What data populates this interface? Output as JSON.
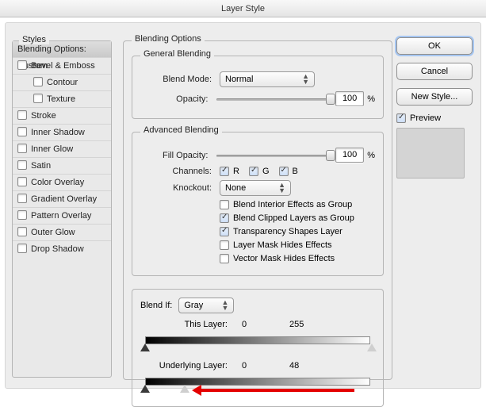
{
  "title": "Layer Style",
  "styles": {
    "header": "Styles",
    "selected": "Blending Options: Custom",
    "items": [
      "Bevel & Emboss",
      "Contour",
      "Texture",
      "Stroke",
      "Inner Shadow",
      "Inner Glow",
      "Satin",
      "Color Overlay",
      "Gradient Overlay",
      "Pattern Overlay",
      "Outer Glow",
      "Drop Shadow"
    ]
  },
  "blend": {
    "groupTitle": "Blending Options",
    "general": {
      "title": "General Blending",
      "modeLabel": "Blend Mode:",
      "modeValue": "Normal",
      "opacityLabel": "Opacity:",
      "opacityValue": "100",
      "pct": "%"
    },
    "adv": {
      "title": "Advanced Blending",
      "fillLabel": "Fill Opacity:",
      "fillValue": "100",
      "pct": "%",
      "channelsLabel": "Channels:",
      "ch": {
        "r": "R",
        "g": "G",
        "b": "B"
      },
      "knockoutLabel": "Knockout:",
      "knockoutValue": "None",
      "opts": {
        "o1": "Blend Interior Effects as Group",
        "o2": "Blend Clipped Layers as Group",
        "o3": "Transparency Shapes Layer",
        "o4": "Layer Mask Hides Effects",
        "o5": "Vector Mask Hides Effects"
      }
    },
    "blendif": {
      "label": "Blend If:",
      "value": "Gray",
      "thisLabel": "This Layer:",
      "thisLow": "0",
      "thisHigh": "255",
      "underLabel": "Underlying Layer:",
      "underLow": "0",
      "underHigh": "48"
    }
  },
  "buttons": {
    "ok": "OK",
    "cancel": "Cancel",
    "newstyle": "New Style...",
    "preview": "Preview"
  }
}
